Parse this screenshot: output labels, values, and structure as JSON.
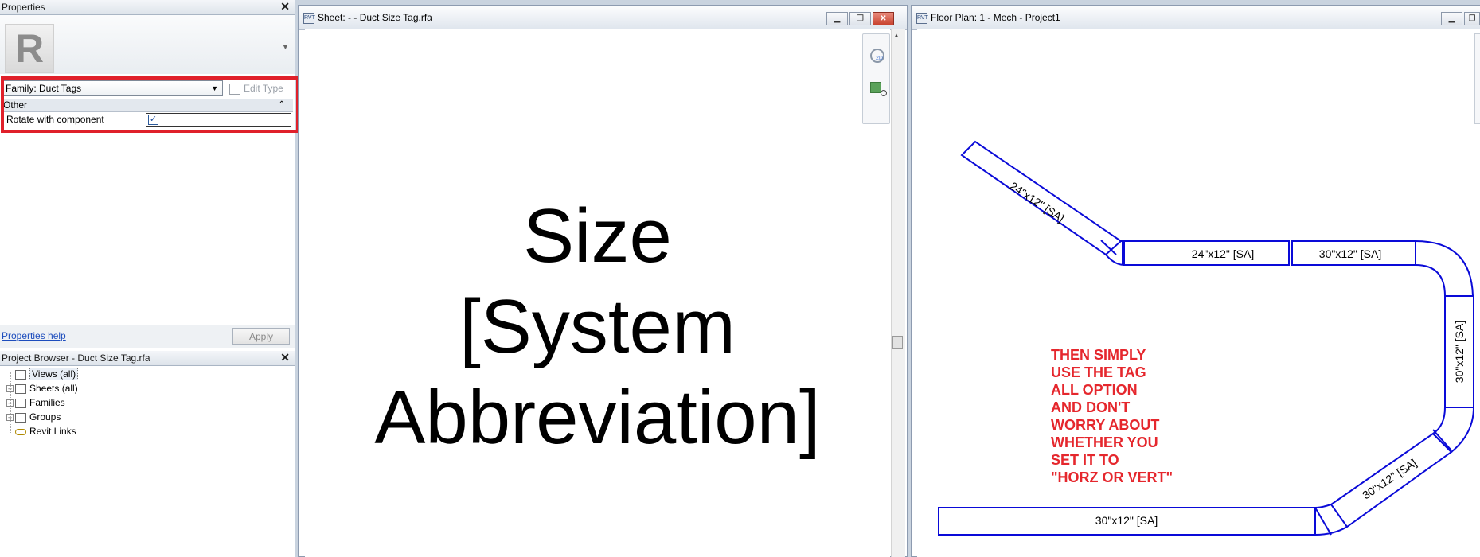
{
  "properties": {
    "title": "Properties",
    "family_select": "Family: Duct Tags",
    "edit_type": "Edit Type",
    "group_header": "Other",
    "param_label": "Rotate with component",
    "param_checked_glyph": "✓",
    "help_link": "Properties help",
    "apply_button": "Apply",
    "revit_letter": "R"
  },
  "project_browser": {
    "title": "Project Browser - Duct Size Tag.rfa",
    "items": [
      {
        "label": "Views (all)"
      },
      {
        "label": "Sheets (all)"
      },
      {
        "label": "Families"
      },
      {
        "label": "Groups"
      },
      {
        "label": "Revit Links"
      }
    ]
  },
  "sheet_window": {
    "title": "Sheet:  -  - Duct Size Tag.rfa",
    "lines": [
      "Size",
      "[System",
      "Abbreviation]"
    ],
    "nav_2d": "2D"
  },
  "floorplan_window": {
    "title": "Floor Plan: 1 - Mech - Project1",
    "duct_labels": [
      "24\"x12\" [SA]",
      "24\"x12\" [SA]",
      "30\"x12\" [SA]",
      "30\"x12\" [SA]",
      "30\"x12\" [SA]",
      "30\"x12\" [SA]"
    ],
    "note_lines": [
      "THEN SIMPLY",
      "USE THE TAG",
      "ALL OPTION",
      "AND DON'T",
      "WORRY ABOUT",
      "WHETHER YOU",
      "SET IT TO",
      "\"HORZ OR VERT\""
    ]
  },
  "colors": {
    "duct_line": "#0a0ad8",
    "highlight_box": "#e0202a",
    "note_text": "#e5272d"
  }
}
